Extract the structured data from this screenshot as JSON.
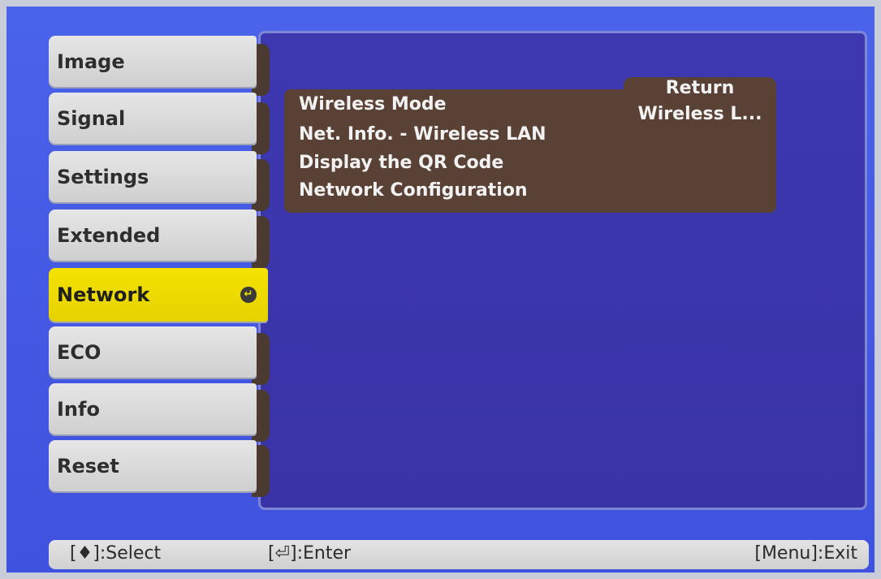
{
  "sidebar": {
    "items": [
      {
        "label": "Image"
      },
      {
        "label": "Signal"
      },
      {
        "label": "Settings"
      },
      {
        "label": "Extended"
      },
      {
        "label": "Network"
      },
      {
        "label": "ECO"
      },
      {
        "label": "Info"
      },
      {
        "label": "Reset"
      }
    ],
    "active_item": "Network",
    "active_color": "#f0df00"
  },
  "main": {
    "return_label": "Return",
    "items": [
      {
        "label": "Wireless Mode",
        "value": "Wireless L..."
      },
      {
        "label": "Net. Info. - Wireless LAN"
      },
      {
        "label": "Display the QR Code"
      },
      {
        "label": "Network Configuration"
      }
    ]
  },
  "status_bar": {
    "select_hint": "[♦]:Select",
    "enter_hint": "[⏎]:Enter",
    "exit_hint": "[Menu]:Exit"
  },
  "colors": {
    "background": "#4a5ce6",
    "panel": "#3b36ab",
    "list": "#5a4136",
    "active_tab": "#f0df00"
  },
  "icons": [
    "enter-icon",
    "select-arrows-icon"
  ]
}
